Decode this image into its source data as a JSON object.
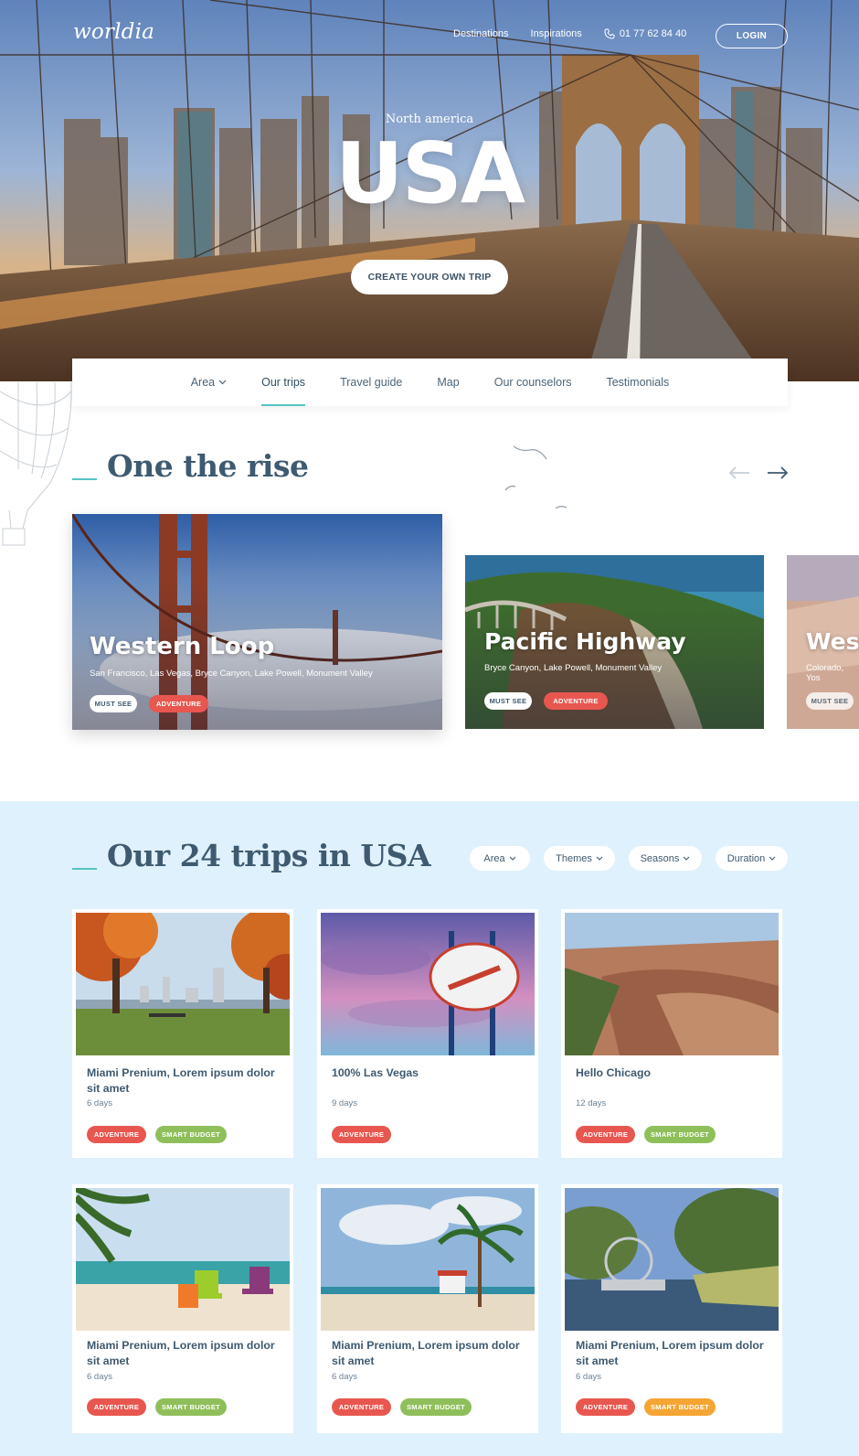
{
  "header": {
    "logo": "worldia",
    "nav": [
      "Destinations",
      "Inspirations"
    ],
    "phone": "01 77 62 84 40",
    "login": "LOGIN"
  },
  "hero": {
    "subtitle": "North america",
    "title": "USA",
    "cta": "CREATE YOUR OWN TRIP"
  },
  "subnav": {
    "items": [
      "Area",
      "Our trips",
      "Travel guide",
      "Map",
      "Our counselors",
      "Testimonials"
    ],
    "active": "Our trips"
  },
  "rise": {
    "title": "One the rise",
    "cards": [
      {
        "title": "Western Loop",
        "subtitle": "San Francisco, Las Vegas, Bryce Canyon, Lake Powell, Monument Valley",
        "badges": [
          "MUST SEE",
          "ADVENTURE"
        ]
      },
      {
        "title": "Pacific Highway",
        "subtitle": "Bryce Canyon, Lake Powell, Monument Valley",
        "badges": [
          "MUST SEE",
          "ADVENTURE"
        ]
      },
      {
        "title": "West",
        "subtitle": "Colorado, Yos",
        "badges": [
          "MUST SEE"
        ]
      }
    ]
  },
  "trips": {
    "title": "Our 24 trips in USA",
    "filters": [
      "Area",
      "Themes",
      "Seasons",
      "Duration"
    ],
    "cards": [
      {
        "title": "Miami Prenium, Lorem ipsum dolor sit amet",
        "days": "6 days",
        "badges": [
          "ADVENTURE",
          "SMART BUDGET"
        ]
      },
      {
        "title": "100% Las Vegas",
        "days": "9 days",
        "badges": [
          "ADVENTURE"
        ]
      },
      {
        "title": "Hello Chicago",
        "days": "12 days",
        "badges": [
          "ADVENTURE",
          "SMART BUDGET"
        ]
      },
      {
        "title": "Miami Prenium, Lorem ipsum dolor sit amet",
        "days": "6 days",
        "badges": [
          "ADVENTURE",
          "SMART BUDGET"
        ]
      },
      {
        "title": "Miami Prenium, Lorem ipsum dolor sit amet",
        "days": "6 days",
        "badges": [
          "ADVENTURE",
          "SMART BUDGET"
        ]
      },
      {
        "title": "Miami Prenium, Lorem ipsum dolor sit amet",
        "days": "6 days",
        "badges": [
          "ADVENTURE",
          "SMART BUDGET"
        ]
      }
    ]
  },
  "colors": {
    "accent": "#55c3c2",
    "heading": "#3e5a70",
    "adventure": "#e8574f",
    "smart_budget": "#8fbf5a",
    "smart_budget_alt": "#f5a533",
    "trips_bg": "#dff1fc"
  }
}
